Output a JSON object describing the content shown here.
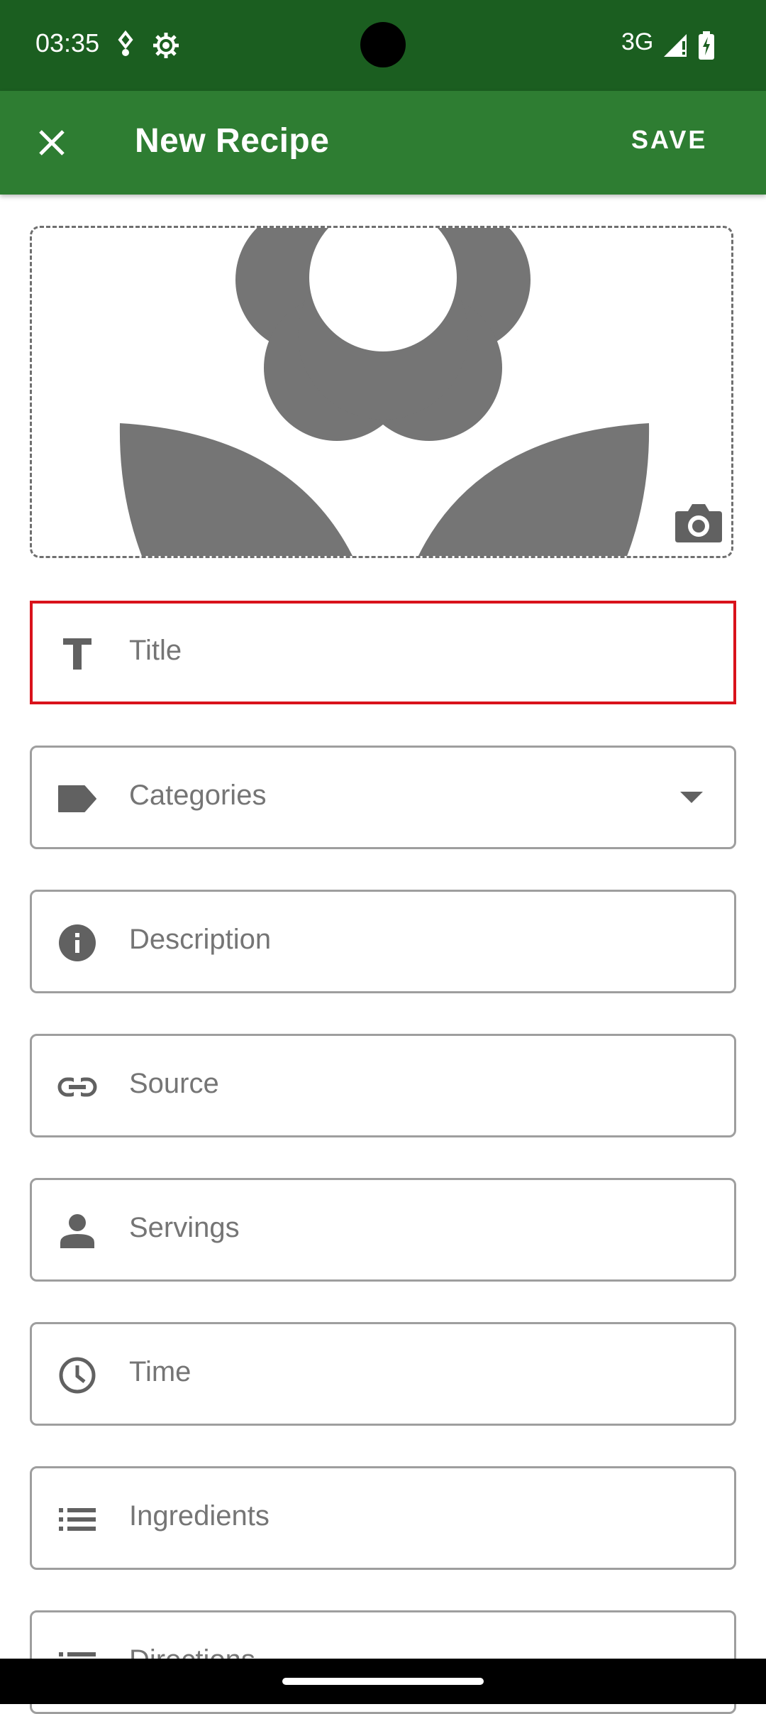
{
  "status_bar": {
    "time": "03:35",
    "network": "3G",
    "icons": [
      "usb-debug-icon",
      "settings-gear-icon",
      "signal-icon",
      "battery-charging-icon"
    ]
  },
  "app_bar": {
    "title": "New Recipe",
    "save_label": "SAVE",
    "close_icon": "close-icon"
  },
  "image_area": {
    "placeholder_icon": "flower-placeholder-icon",
    "camera_icon": "camera-icon"
  },
  "form": {
    "fields": [
      {
        "label": "Title",
        "icon": "text-format-icon",
        "state": "error"
      },
      {
        "label": "Categories",
        "icon": "label-tag-icon",
        "type": "dropdown"
      },
      {
        "label": "Description",
        "icon": "info-icon"
      },
      {
        "label": "Source",
        "icon": "link-icon"
      },
      {
        "label": "Servings",
        "icon": "person-icon"
      },
      {
        "label": "Time",
        "icon": "clock-icon"
      },
      {
        "label": "Ingredients",
        "icon": "list-icon"
      },
      {
        "label": "Directions",
        "icon": "numbered-list-icon"
      }
    ]
  },
  "colors": {
    "status_bar": "#1b5e20",
    "app_bar": "#2e7d32",
    "error": "#d9121b",
    "icon_gray": "#616161",
    "hint_text": "#757575"
  }
}
